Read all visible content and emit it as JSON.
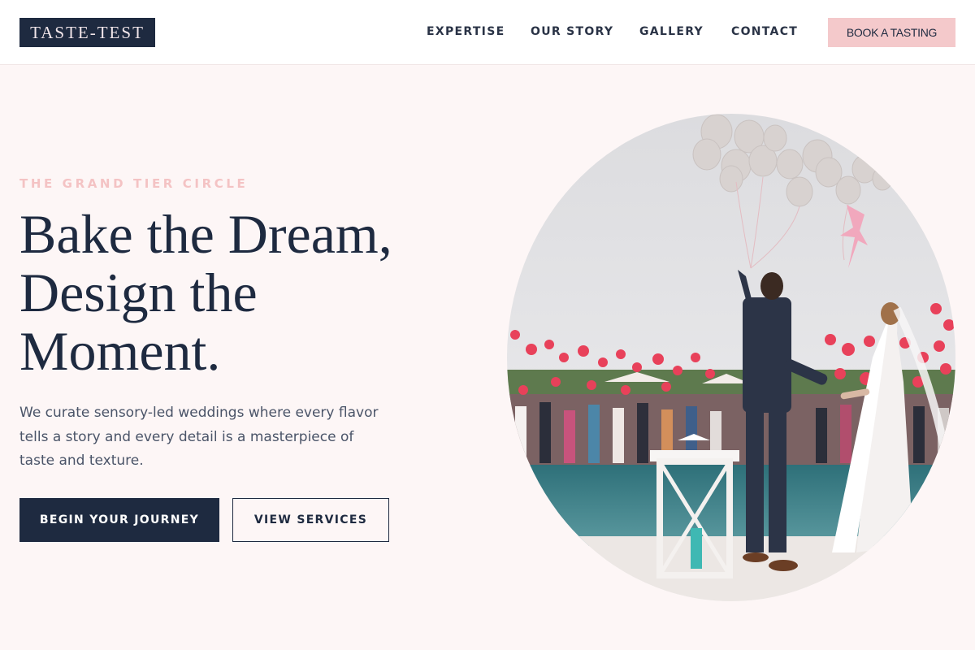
{
  "header": {
    "logo": "TASTE-TEST",
    "nav": [
      "EXPERTISE",
      "OUR STORY",
      "GALLERY",
      "CONTACT"
    ],
    "cta": "BOOK A TASTING"
  },
  "hero": {
    "eyebrow": "THE GRAND TIER CIRCLE",
    "headline_lines": [
      "Bake the Dream,",
      "Design the",
      "Moment."
    ],
    "lede_lines": [
      "We curate sensory-led weddings where every flavor",
      "tells a story and every detail is a masterpiece of",
      "taste and texture."
    ],
    "primary_button": "BEGIN YOUR JOURNEY",
    "secondary_button": "VIEW SERVICES",
    "photo": {
      "name": "wedding-couple-balloons-photo"
    }
  },
  "colors": {
    "navy": "#1e2a40",
    "blush": "#f4c9cb",
    "eyebrow_pink": "#f4c3c4",
    "page_background": "#fdf6f6"
  }
}
